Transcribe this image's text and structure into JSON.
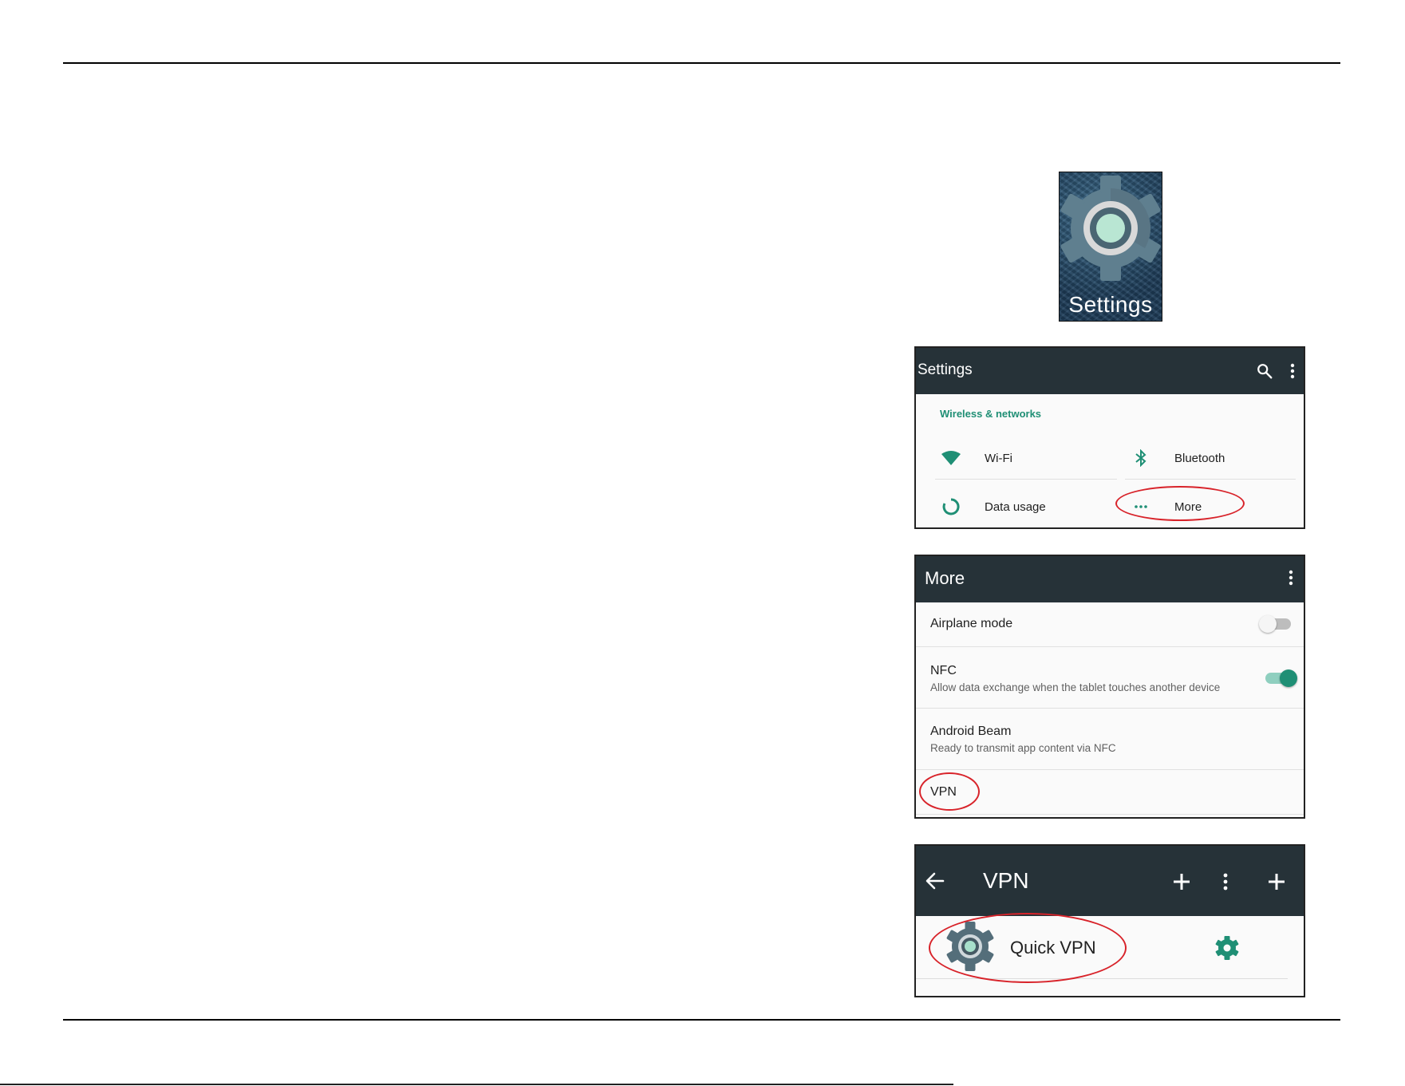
{
  "app_icon": {
    "label": "Settings",
    "icon": "gear-icon"
  },
  "settings_screen": {
    "title": "Settings",
    "actions": {
      "search_icon": "search-icon",
      "overflow_icon": "more-vert-icon"
    },
    "section_title": "Wireless & networks",
    "tiles": [
      {
        "label": "Wi-Fi",
        "icon": "wifi-icon"
      },
      {
        "label": "Bluetooth",
        "icon": "bluetooth-icon"
      },
      {
        "label": "Data usage",
        "icon": "data-usage-icon"
      },
      {
        "label": "More",
        "icon": "more-horiz-icon"
      }
    ],
    "accent_color": "#1f8f75"
  },
  "more_screen": {
    "title": "More",
    "rows": [
      {
        "title": "Airplane mode",
        "toggle_on": false
      },
      {
        "title": "NFC",
        "subtitle": "Allow data exchange when the tablet touches another device",
        "toggle_on": true
      },
      {
        "title": "Android Beam",
        "subtitle": "Ready to transmit app content via NFC"
      },
      {
        "title": "VPN"
      }
    ]
  },
  "vpn_screen": {
    "title": "VPN",
    "entry": {
      "name": "Quick VPN",
      "icon": "gear-icon",
      "settings_icon": "settings-icon"
    }
  },
  "colors": {
    "toolbar": "#263238",
    "accent": "#1f8f75",
    "highlight": "#d8232a",
    "icon_gray": "#546e7a"
  }
}
